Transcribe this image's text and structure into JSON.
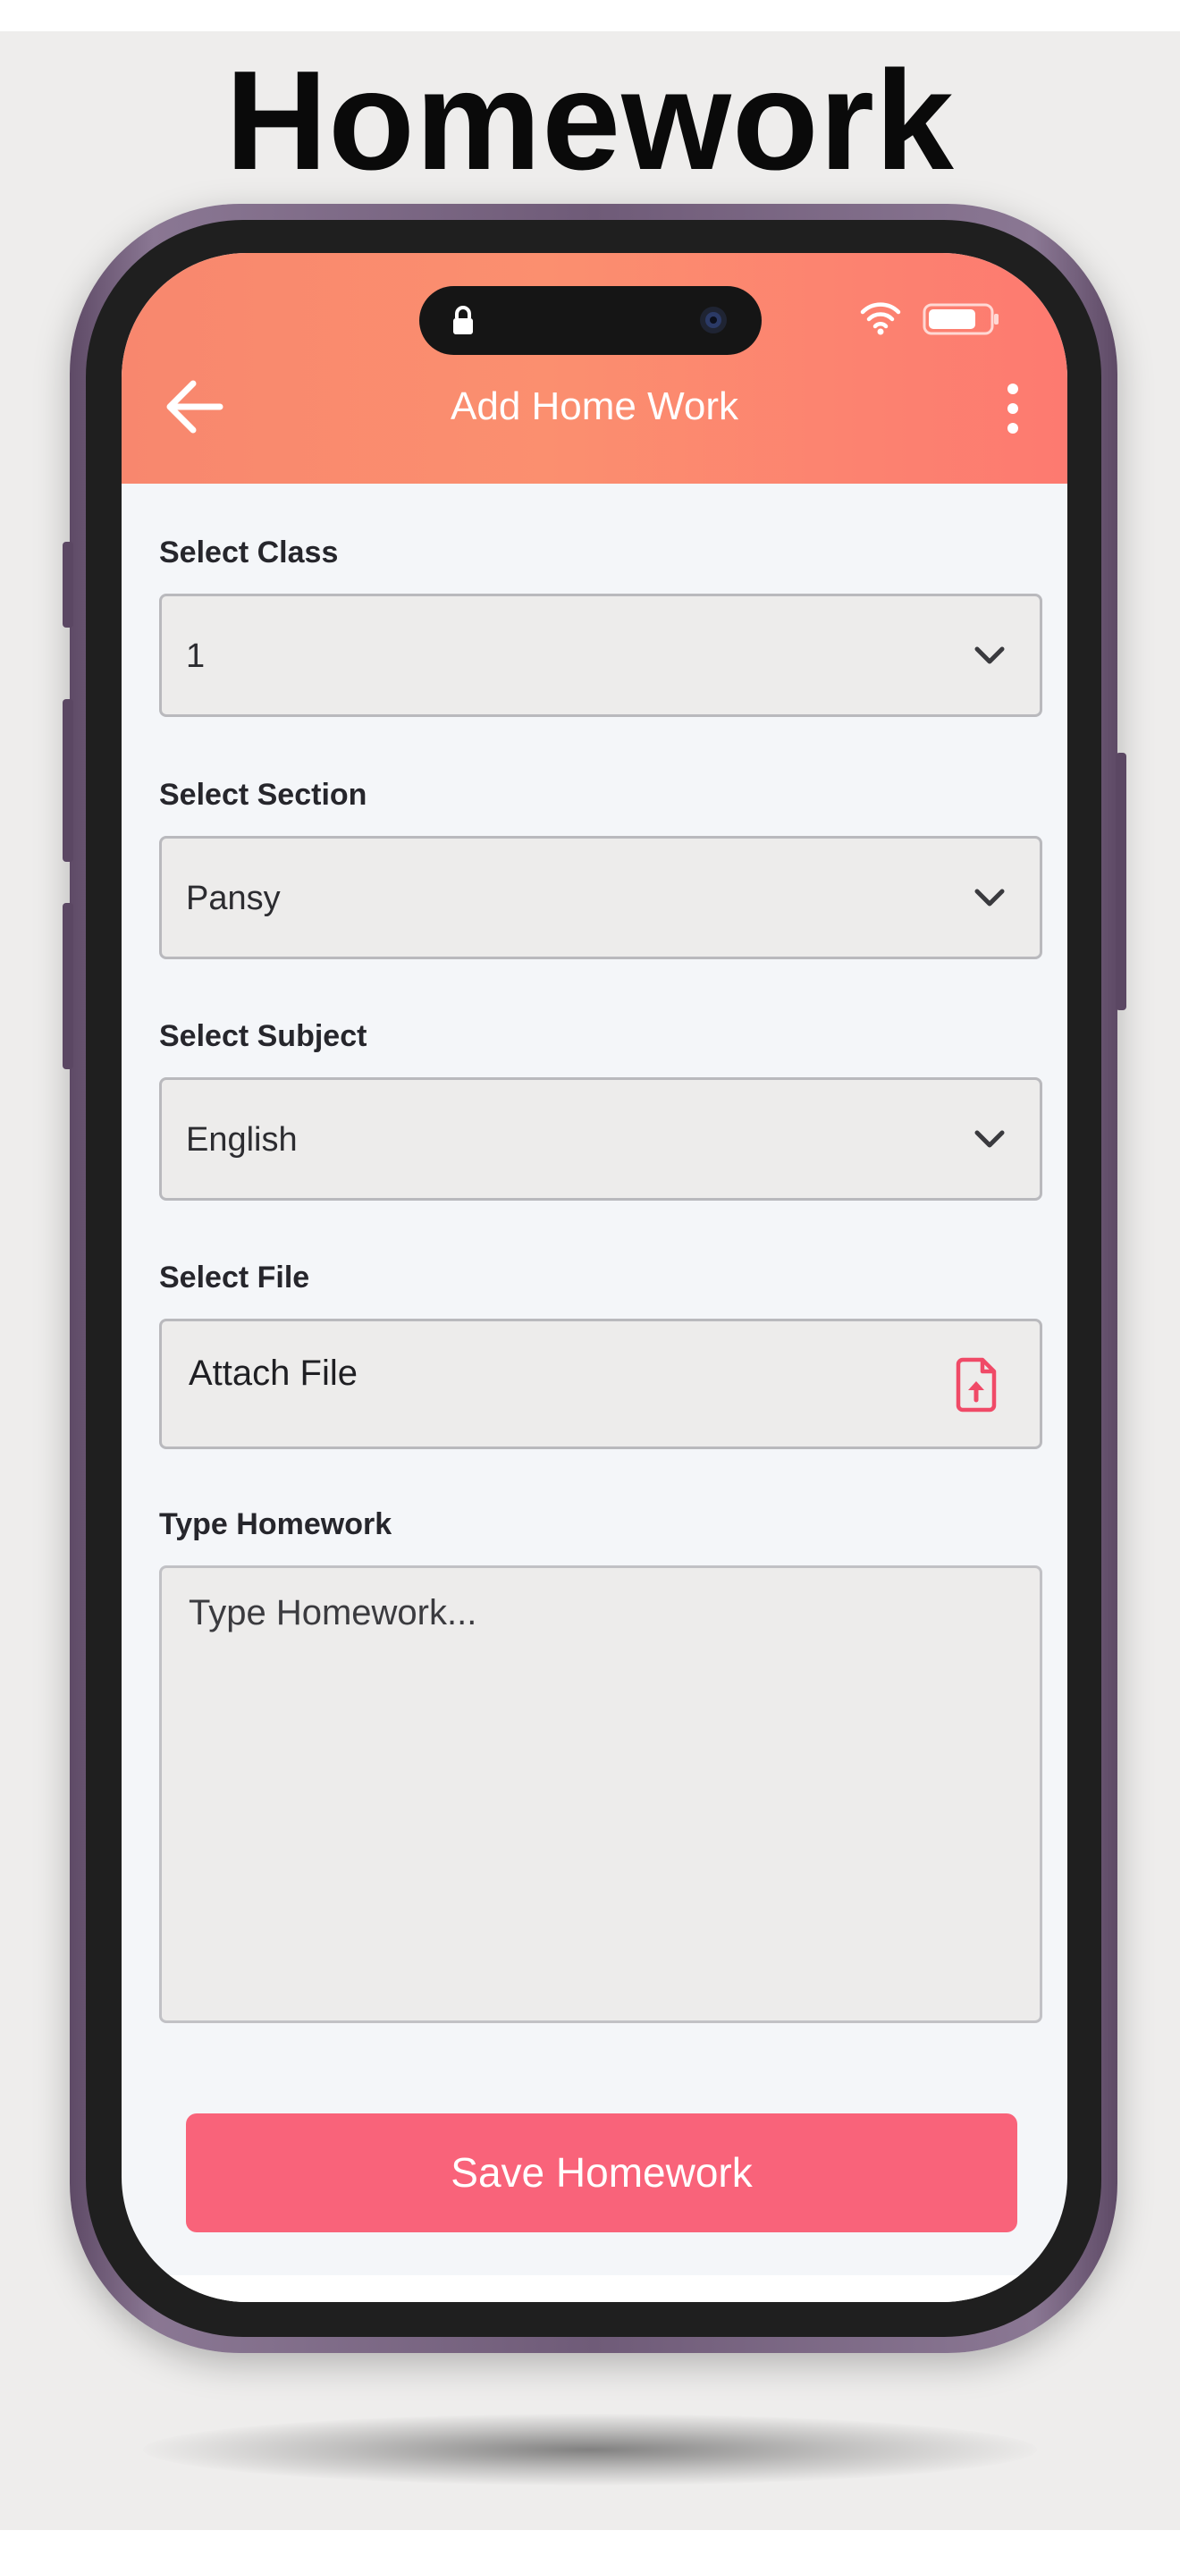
{
  "page": {
    "heading": "Homework"
  },
  "header": {
    "title": "Add Home Work"
  },
  "form": {
    "class": {
      "label": "Select Class",
      "value": "1"
    },
    "section": {
      "label": "Select Section",
      "value": "Pansy"
    },
    "subject": {
      "label": "Select Subject",
      "value": "English"
    },
    "file": {
      "label": "Select File",
      "value": "Attach File"
    },
    "homework": {
      "label": "Type Homework",
      "placeholder": "Type Homework..."
    }
  },
  "actions": {
    "save_label": "Save Homework"
  },
  "icons": {
    "back": "arrow-left-icon",
    "more": "more-vertical-icon",
    "dropdown": "chevron-down-icon",
    "file_upload": "file-upload-icon",
    "status_lock": "lock-icon",
    "status_wifi": "wifi-icon",
    "status_battery": "battery-icon"
  },
  "colors": {
    "header_start": "#f8876e",
    "header_end": "#fd7a70",
    "save_button": "#f9637a",
    "file_icon": "#f04a67",
    "phone_frame": "#6f5b78"
  }
}
